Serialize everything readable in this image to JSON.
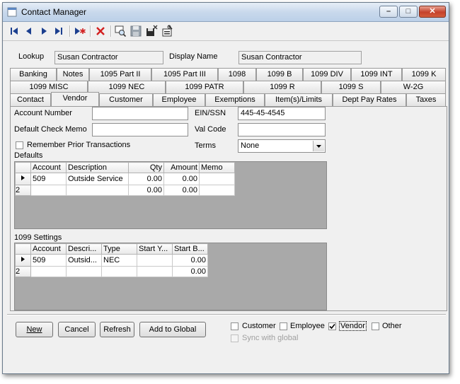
{
  "window": {
    "title": "Contact Manager"
  },
  "lookup": {
    "label": "Lookup",
    "value": "Susan Contractor"
  },
  "display_name": {
    "label": "Display Name",
    "value": "Susan Contractor"
  },
  "tabs_row1": [
    "Banking",
    "Notes",
    "1095 Part II",
    "1095 Part III",
    "1098",
    "1099 B",
    "1099 DIV",
    "1099 INT",
    "1099 K"
  ],
  "tabs_row2": [
    "1099 MISC",
    "1099 NEC",
    "1099 PATR",
    "1099 R",
    "1099 S",
    "W-2G"
  ],
  "tabs_row3": [
    "Contact",
    "Vendor",
    "Customer",
    "Employee",
    "Exemptions",
    "Item(s)/Limits",
    "Dept Pay Rates",
    "Taxes"
  ],
  "vendor": {
    "account_number_label": "Account Number",
    "account_number_value": "",
    "default_check_memo_label": "Default Check Memo",
    "default_check_memo_value": "",
    "remember_prior_label": "Remember Prior Transactions",
    "ein_label": "EIN/SSN",
    "ein_value": "445-45-4545",
    "val_code_label": "Val Code",
    "val_code_value": "",
    "terms_label": "Terms",
    "terms_value": "None",
    "defaults_label": "Defaults",
    "defaults_grid": {
      "columns": [
        "Account",
        "Description",
        "Qty",
        "Amount",
        "Memo"
      ],
      "rows": [
        {
          "row": "",
          "account": "509",
          "description": "Outside Service",
          "qty": "0.00",
          "amount": "0.00",
          "memo": ""
        },
        {
          "row": "2",
          "account": "",
          "description": "",
          "qty": "0.00",
          "amount": "0.00",
          "memo": ""
        }
      ]
    },
    "settings_label": "1099 Settings",
    "settings_grid": {
      "columns": [
        "Account",
        "Descri...",
        "Type",
        "Start Y...",
        "Start B..."
      ],
      "rows": [
        {
          "row": "",
          "account": "509",
          "description": "Outsid...",
          "type": "NEC",
          "start_y": "",
          "start_b": "0.00"
        },
        {
          "row": "2",
          "account": "",
          "description": "",
          "type": "",
          "start_y": "",
          "start_b": "0.00"
        }
      ]
    }
  },
  "buttons": {
    "new": "New",
    "cancel": "Cancel",
    "refresh": "Refresh",
    "add_global": "Add to Global"
  },
  "contact_types": {
    "customer": "Customer",
    "employee": "Employee",
    "vendor": "Vendor",
    "other": "Other",
    "sync": "Sync with global"
  }
}
